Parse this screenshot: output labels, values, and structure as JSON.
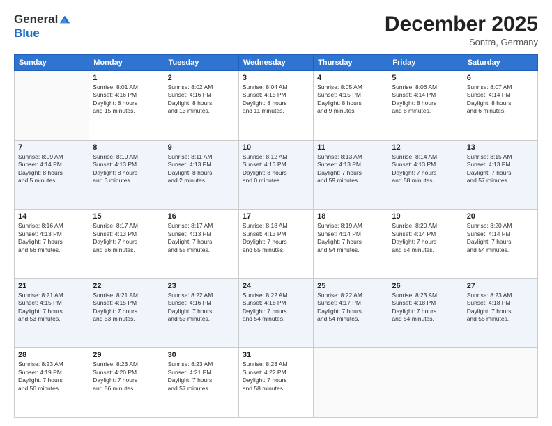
{
  "logo": {
    "general": "General",
    "blue": "Blue"
  },
  "header": {
    "month": "December 2025",
    "location": "Sontra, Germany"
  },
  "days_of_week": [
    "Sunday",
    "Monday",
    "Tuesday",
    "Wednesday",
    "Thursday",
    "Friday",
    "Saturday"
  ],
  "weeks": [
    [
      {
        "day": "",
        "info": ""
      },
      {
        "day": "1",
        "info": "Sunrise: 8:01 AM\nSunset: 4:16 PM\nDaylight: 8 hours\nand 15 minutes."
      },
      {
        "day": "2",
        "info": "Sunrise: 8:02 AM\nSunset: 4:16 PM\nDaylight: 8 hours\nand 13 minutes."
      },
      {
        "day": "3",
        "info": "Sunrise: 8:04 AM\nSunset: 4:15 PM\nDaylight: 8 hours\nand 11 minutes."
      },
      {
        "day": "4",
        "info": "Sunrise: 8:05 AM\nSunset: 4:15 PM\nDaylight: 8 hours\nand 9 minutes."
      },
      {
        "day": "5",
        "info": "Sunrise: 8:06 AM\nSunset: 4:14 PM\nDaylight: 8 hours\nand 8 minutes."
      },
      {
        "day": "6",
        "info": "Sunrise: 8:07 AM\nSunset: 4:14 PM\nDaylight: 8 hours\nand 6 minutes."
      }
    ],
    [
      {
        "day": "7",
        "info": "Sunrise: 8:09 AM\nSunset: 4:14 PM\nDaylight: 8 hours\nand 5 minutes."
      },
      {
        "day": "8",
        "info": "Sunrise: 8:10 AM\nSunset: 4:13 PM\nDaylight: 8 hours\nand 3 minutes."
      },
      {
        "day": "9",
        "info": "Sunrise: 8:11 AM\nSunset: 4:13 PM\nDaylight: 8 hours\nand 2 minutes."
      },
      {
        "day": "10",
        "info": "Sunrise: 8:12 AM\nSunset: 4:13 PM\nDaylight: 8 hours\nand 0 minutes."
      },
      {
        "day": "11",
        "info": "Sunrise: 8:13 AM\nSunset: 4:13 PM\nDaylight: 7 hours\nand 59 minutes."
      },
      {
        "day": "12",
        "info": "Sunrise: 8:14 AM\nSunset: 4:13 PM\nDaylight: 7 hours\nand 58 minutes."
      },
      {
        "day": "13",
        "info": "Sunrise: 8:15 AM\nSunset: 4:13 PM\nDaylight: 7 hours\nand 57 minutes."
      }
    ],
    [
      {
        "day": "14",
        "info": "Sunrise: 8:16 AM\nSunset: 4:13 PM\nDaylight: 7 hours\nand 56 minutes."
      },
      {
        "day": "15",
        "info": "Sunrise: 8:17 AM\nSunset: 4:13 PM\nDaylight: 7 hours\nand 56 minutes."
      },
      {
        "day": "16",
        "info": "Sunrise: 8:17 AM\nSunset: 4:13 PM\nDaylight: 7 hours\nand 55 minutes."
      },
      {
        "day": "17",
        "info": "Sunrise: 8:18 AM\nSunset: 4:13 PM\nDaylight: 7 hours\nand 55 minutes."
      },
      {
        "day": "18",
        "info": "Sunrise: 8:19 AM\nSunset: 4:14 PM\nDaylight: 7 hours\nand 54 minutes."
      },
      {
        "day": "19",
        "info": "Sunrise: 8:20 AM\nSunset: 4:14 PM\nDaylight: 7 hours\nand 54 minutes."
      },
      {
        "day": "20",
        "info": "Sunrise: 8:20 AM\nSunset: 4:14 PM\nDaylight: 7 hours\nand 54 minutes."
      }
    ],
    [
      {
        "day": "21",
        "info": "Sunrise: 8:21 AM\nSunset: 4:15 PM\nDaylight: 7 hours\nand 53 minutes."
      },
      {
        "day": "22",
        "info": "Sunrise: 8:21 AM\nSunset: 4:15 PM\nDaylight: 7 hours\nand 53 minutes."
      },
      {
        "day": "23",
        "info": "Sunrise: 8:22 AM\nSunset: 4:16 PM\nDaylight: 7 hours\nand 53 minutes."
      },
      {
        "day": "24",
        "info": "Sunrise: 8:22 AM\nSunset: 4:16 PM\nDaylight: 7 hours\nand 54 minutes."
      },
      {
        "day": "25",
        "info": "Sunrise: 8:22 AM\nSunset: 4:17 PM\nDaylight: 7 hours\nand 54 minutes."
      },
      {
        "day": "26",
        "info": "Sunrise: 8:23 AM\nSunset: 4:18 PM\nDaylight: 7 hours\nand 54 minutes."
      },
      {
        "day": "27",
        "info": "Sunrise: 8:23 AM\nSunset: 4:18 PM\nDaylight: 7 hours\nand 55 minutes."
      }
    ],
    [
      {
        "day": "28",
        "info": "Sunrise: 8:23 AM\nSunset: 4:19 PM\nDaylight: 7 hours\nand 56 minutes."
      },
      {
        "day": "29",
        "info": "Sunrise: 8:23 AM\nSunset: 4:20 PM\nDaylight: 7 hours\nand 56 minutes."
      },
      {
        "day": "30",
        "info": "Sunrise: 8:23 AM\nSunset: 4:21 PM\nDaylight: 7 hours\nand 57 minutes."
      },
      {
        "day": "31",
        "info": "Sunrise: 8:23 AM\nSunset: 4:22 PM\nDaylight: 7 hours\nand 58 minutes."
      },
      {
        "day": "",
        "info": ""
      },
      {
        "day": "",
        "info": ""
      },
      {
        "day": "",
        "info": ""
      }
    ]
  ]
}
